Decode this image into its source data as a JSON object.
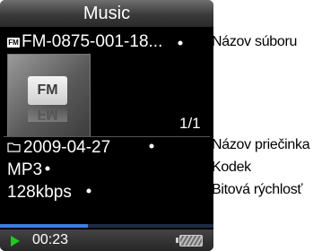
{
  "screen": {
    "title": "Music",
    "file_name": "FM-0875-001-18...",
    "file_badge": "FM",
    "art_label": "FM",
    "track_count": "1/1",
    "folder_name": "2009-04-27",
    "codec": "MP3",
    "bitrate": "128kbps",
    "elapsed_time": "00:23",
    "progress_fraction": 0.41,
    "icons": {
      "file": "fm-file-icon",
      "folder": "folder-icon",
      "play": "play-icon",
      "battery": "battery-icon"
    },
    "colors": {
      "play": "#18d018",
      "progress": "#3d7fe0"
    }
  },
  "callouts": {
    "file_name": "Názov súboru",
    "folder_name": "Názov priečinka",
    "codec": "Kodek",
    "bitrate": "Bitová rýchlosť"
  }
}
